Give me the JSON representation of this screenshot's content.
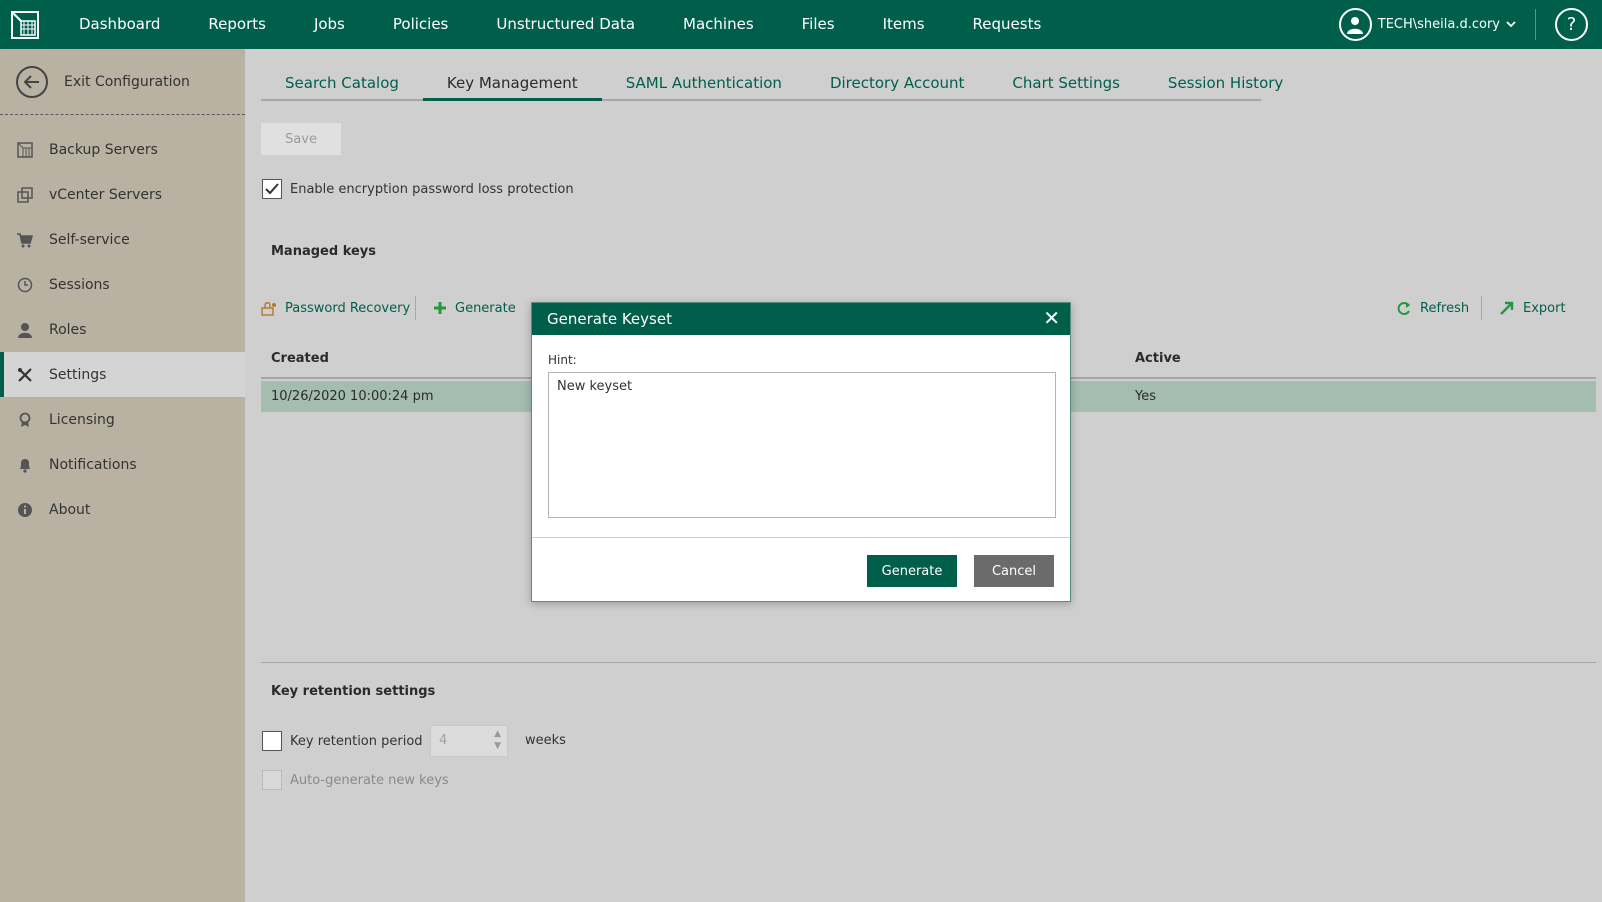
{
  "topbar": {
    "nav": [
      "Dashboard",
      "Reports",
      "Jobs",
      "Policies",
      "Unstructured Data",
      "Machines",
      "Files",
      "Items",
      "Requests"
    ],
    "user": "TECH\\sheila.d.cory",
    "help": "?"
  },
  "sidebar": {
    "exit": "Exit Configuration",
    "items": [
      {
        "label": "Backup Servers",
        "icon": "server-icon"
      },
      {
        "label": "vCenter Servers",
        "icon": "vcenter-icon"
      },
      {
        "label": "Self-service",
        "icon": "cart-icon"
      },
      {
        "label": "Sessions",
        "icon": "clock-icon"
      },
      {
        "label": "Roles",
        "icon": "person-icon"
      },
      {
        "label": "Settings",
        "icon": "tools-icon"
      },
      {
        "label": "Licensing",
        "icon": "license-icon"
      },
      {
        "label": "Notifications",
        "icon": "bell-icon"
      },
      {
        "label": "About",
        "icon": "info-icon"
      }
    ],
    "active": "Settings"
  },
  "tabs": [
    "Search Catalog",
    "Key Management",
    "SAML Authentication",
    "Directory Account",
    "Chart Settings",
    "Session History"
  ],
  "active_tab": "Key Management",
  "main": {
    "save": "Save",
    "enable_protection": "Enable encryption password loss protection",
    "managed_keys": "Managed keys",
    "toolbar": {
      "password_recovery": "Password Recovery",
      "generate": "Generate",
      "refresh": "Refresh",
      "export": "Export"
    },
    "columns": {
      "created": "Created",
      "active": "Active"
    },
    "row": {
      "created": "10/26/2020 10:00:24 pm",
      "active": "Yes"
    },
    "retention_title": "Key retention settings",
    "retention_period": "Key retention period",
    "retention_value": "4",
    "weeks": "weeks",
    "auto_generate": "Auto-generate new keys"
  },
  "modal": {
    "title": "Generate Keyset",
    "hint_label": "Hint:",
    "hint_value": "New keyset",
    "generate": "Generate",
    "cancel": "Cancel"
  },
  "colors": {
    "brand": "#005f4b",
    "sidebar": "#b9b2a3",
    "selected_row": "#a5bdb1"
  }
}
